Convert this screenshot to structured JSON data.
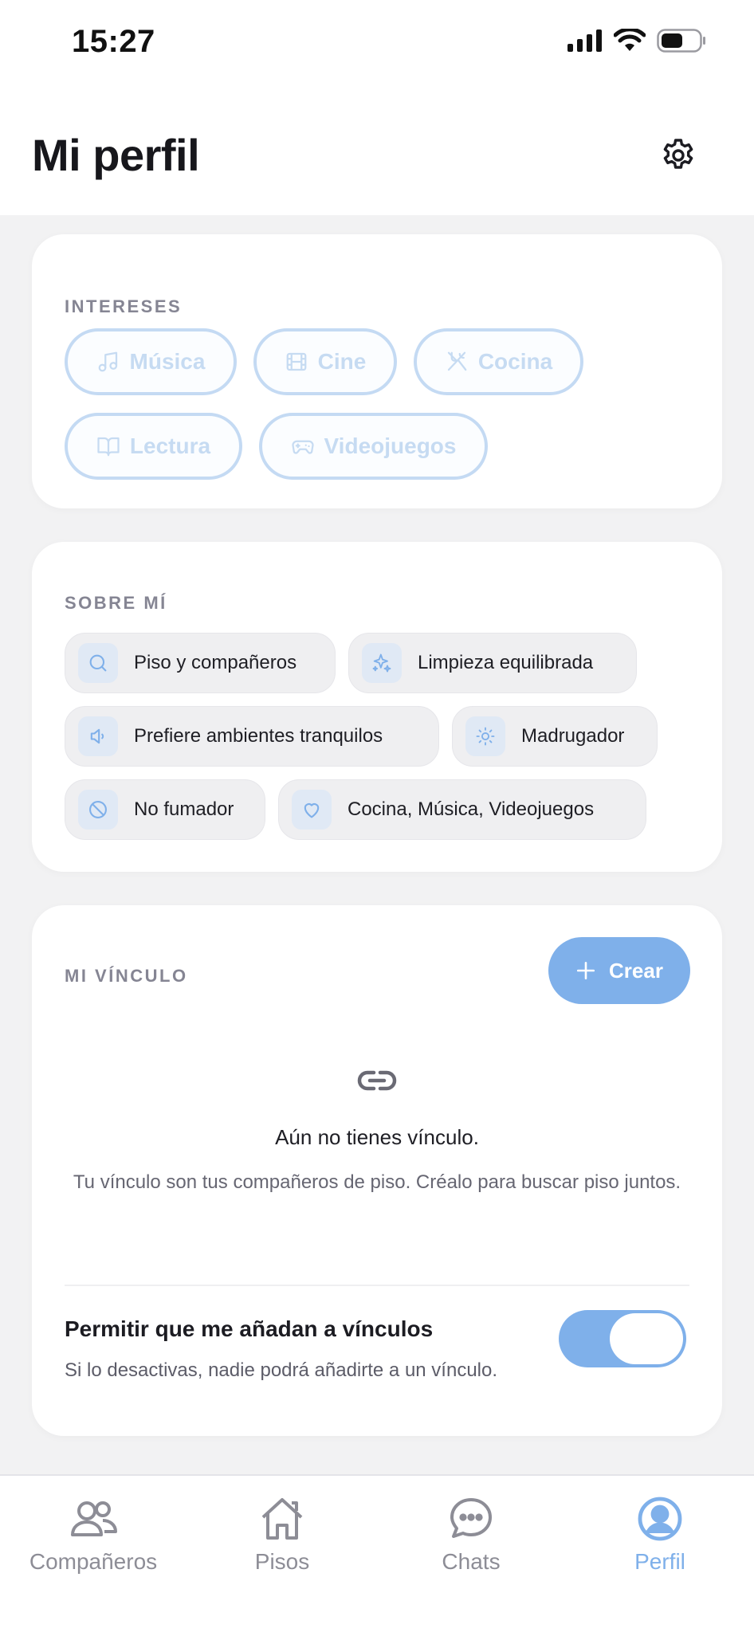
{
  "status_bar": {
    "time": "15:27"
  },
  "header": {
    "title": "Mi perfil"
  },
  "interests": {
    "label": "INTERESES",
    "items": [
      {
        "label": "Música",
        "icon": "music-icon"
      },
      {
        "label": "Cine",
        "icon": "film-icon"
      },
      {
        "label": "Cocina",
        "icon": "utensils-icon"
      },
      {
        "label": "Lectura",
        "icon": "book-icon"
      },
      {
        "label": "Videojuegos",
        "icon": "gamepad-icon"
      }
    ]
  },
  "about": {
    "label": "SOBRE MÍ",
    "items": [
      {
        "label": "Piso y compañeros",
        "icon": "search-icon"
      },
      {
        "label": "Limpieza equilibrada",
        "icon": "sparkles-icon"
      },
      {
        "label": "Prefiere ambientes tranquilos",
        "icon": "volume-low-icon"
      },
      {
        "label": "Madrugador",
        "icon": "sun-icon"
      },
      {
        "label": "No fumador",
        "icon": "no-smoking-icon"
      },
      {
        "label": "Cocina, Música, Videojuegos",
        "icon": "heart-icon"
      }
    ]
  },
  "link": {
    "label": "MI VÍNCULO",
    "create_label": "Crear",
    "empty_title": "Aún no tienes vínculo.",
    "empty_desc": "Tu vínculo son tus compañeros de piso. Créalo para buscar piso juntos.",
    "allow_title": "Permitir que me añadan a vínculos",
    "allow_desc": "Si lo desactivas, nadie podrá añadirte a un vínculo.",
    "allow_enabled": true
  },
  "tabs": [
    {
      "label": "Compañeros",
      "icon": "users-icon",
      "active": false
    },
    {
      "label": "Pisos",
      "icon": "home-icon",
      "active": false
    },
    {
      "label": "Chats",
      "icon": "chat-icon",
      "active": false
    },
    {
      "label": "Perfil",
      "icon": "profile-icon",
      "active": true
    }
  ],
  "colors": {
    "accent": "#7fb0ea",
    "accent_light": "#c4daf3",
    "inactive": "#8d8d96"
  }
}
